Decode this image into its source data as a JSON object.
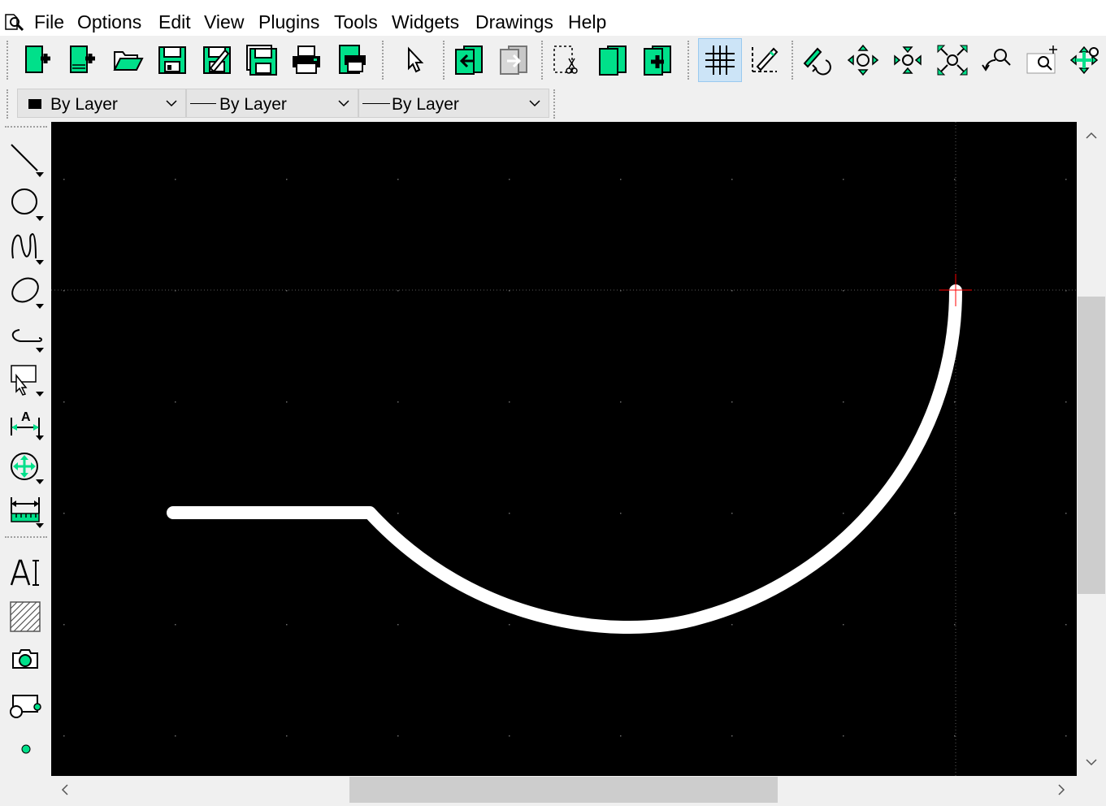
{
  "menu": {
    "items": [
      "File",
      "Options",
      "Edit",
      "View",
      "Plugins",
      "Tools",
      "Widgets",
      "Drawings",
      "Help"
    ]
  },
  "toolbar": {
    "buttons": [
      "new-file",
      "new-from-template",
      "open-file",
      "save",
      "save-as",
      "save-all",
      "print",
      "print-preview",
      "select-pointer",
      "import-block",
      "export-block",
      "cut-to-clipboard",
      "new-block",
      "insert-block",
      "grid-toggle",
      "draft-mode",
      "redraw",
      "zoom-in",
      "zoom-out",
      "zoom-auto",
      "zoom-previous",
      "zoom-window",
      "zoom-pan"
    ],
    "active": "grid-toggle"
  },
  "layer_bar": {
    "color_label": "By Layer",
    "line_width_label": "By Layer",
    "line_type_label": "By Layer"
  },
  "left_tools": [
    "line",
    "circle",
    "curve",
    "ellipse",
    "polyline",
    "select",
    "dimension",
    "modify",
    "info",
    "text",
    "hatch",
    "image",
    "block",
    "point"
  ],
  "colors": {
    "accent_green": "#00e08a",
    "canvas_bg": "#000000",
    "entity": "#ffffff",
    "cursor": "#ff0000",
    "active_button": "#cce4f7"
  }
}
